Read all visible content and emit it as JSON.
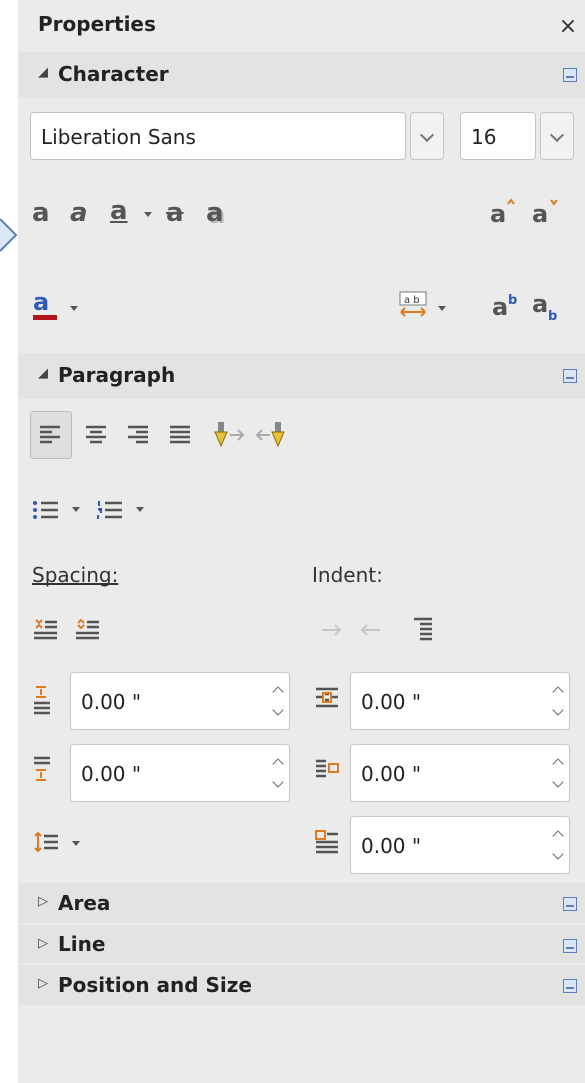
{
  "panel": {
    "title": "Properties",
    "close_glyph": "×"
  },
  "character": {
    "header": "Character",
    "font_name": "Liberation Sans",
    "font_size": "16",
    "style_glyph": "a",
    "font_color": "#b3151a"
  },
  "paragraph": {
    "header": "Paragraph",
    "spacing_label": "Spacing:",
    "indent_label": "Indent:",
    "above_spacing": "0.00 \"",
    "below_spacing": "0.00 \"",
    "before_indent": "0.00 \"",
    "after_indent": "0.00 \"",
    "first_line_indent": "0.00 \""
  },
  "sections": {
    "area": "Area",
    "line": "Line",
    "position_size": "Position and Size"
  },
  "colors": {
    "accent": "#5b7fb6",
    "highlight_orange": "#e07a1f"
  }
}
